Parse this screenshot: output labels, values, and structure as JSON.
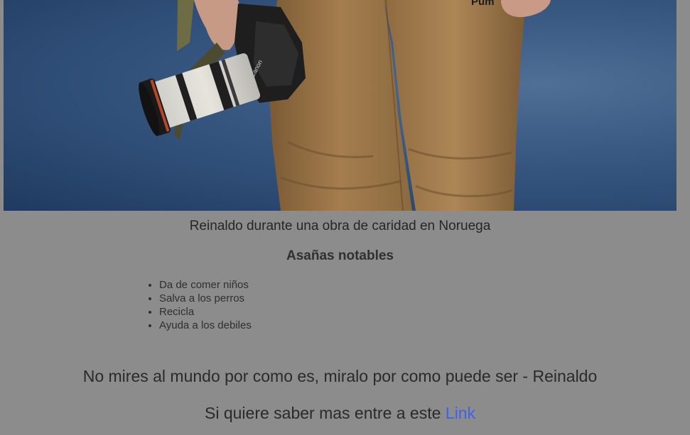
{
  "photo": {
    "brand_text": "Pum",
    "camera_text": "Canon"
  },
  "caption": "Reinaldo durante una obra de caridad en Noruega",
  "heading": "Asañas notables",
  "achievements": [
    "Da de comer niños",
    "Salva a los perros",
    "Recicla",
    "Ayuda a los debiles"
  ],
  "quote": "No mires al mundo por como es, miralo por como puede ser - Reinaldo",
  "more": {
    "text": "Si quiere saber mas entre a este ",
    "link_label": "Link"
  }
}
